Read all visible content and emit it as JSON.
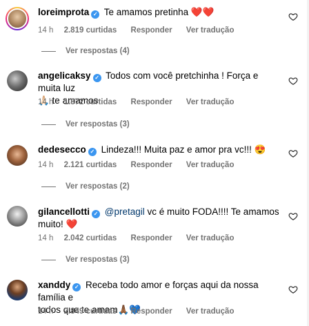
{
  "comments": [
    {
      "username": "loreimprota",
      "text_parts": [
        "Te amamos pretinha ",
        "❤️❤️"
      ],
      "mention": "",
      "time": "14 h",
      "likes": "2.819 curtidas",
      "reply_label": "Responder",
      "translate_label": "Ver tradução",
      "view_replies": "Ver respostas (4)"
    },
    {
      "username": "angelicaksy",
      "text_parts": [
        "Todos com você pretchinha ! Força e muita luz",
        "🙏🏻 te amamos"
      ],
      "mention": "",
      "time": "14 h",
      "likes": "1.872 curtidas",
      "reply_label": "Responder",
      "translate_label": "Ver tradução",
      "view_replies": "Ver respostas (3)"
    },
    {
      "username": "dedesecco",
      "text_parts": [
        "Lindeza!!! Muita paz e amor pra vc!!! 😍",
        ""
      ],
      "mention": "",
      "time": "14 h",
      "likes": "2.121 curtidas",
      "reply_label": "Responder",
      "translate_label": "Ver tradução",
      "view_replies": "Ver respostas (2)"
    },
    {
      "username": "gilancellotti",
      "text_parts": [
        " vc é muito FODA!!!! Te amamos",
        "muito! ❤️"
      ],
      "mention": "@pretagil",
      "time": "14 h",
      "likes": "2.042 curtidas",
      "reply_label": "Responder",
      "translate_label": "Ver tradução",
      "view_replies": "Ver respostas (3)"
    },
    {
      "username": "xanddy",
      "text_parts": [
        "Receba todo amor e forças aqui da nossa família e",
        "todos que te amam🙏🏾💙"
      ],
      "mention": "",
      "time": "14 h",
      "likes": "2.849 curtidas",
      "reply_label": "Responder",
      "translate_label": "Ver tradução",
      "view_replies": ""
    }
  ],
  "colors": {
    "meta_text": "#737373",
    "verified_badge": "#3b96f0",
    "mention": "#00376b"
  },
  "icons": {
    "verified": "verified-badge-icon",
    "like": "heart-outline-icon"
  }
}
